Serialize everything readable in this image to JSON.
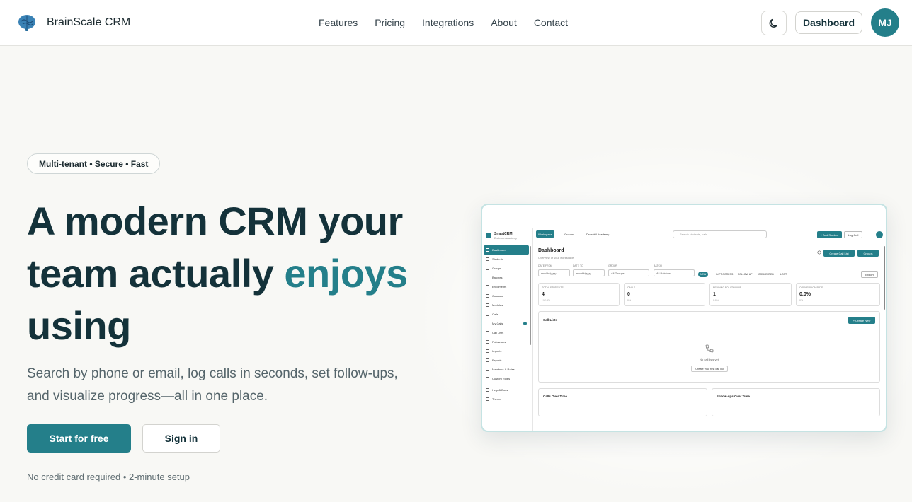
{
  "nav": {
    "brand": "BrainScale CRM",
    "links": [
      "Features",
      "Pricing",
      "Integrations",
      "About",
      "Contact"
    ],
    "dashboard_label": "Dashboard",
    "avatar_initials": "MJ"
  },
  "hero": {
    "pill": "Multi-tenant • Secure • Fast",
    "headline_part1": "A modern CRM your team actually ",
    "headline_accent": "enjoys",
    "headline_part2": " using",
    "subtext": "Search by phone or email, log calls in seconds, set follow-ups, and visualize progress—all in one place.",
    "primary_cta": "Start for free",
    "secondary_cta": "Sign in",
    "footnote": "No credit card required • 2-minute setup"
  },
  "mockup": {
    "brand_title": "SmartCRM",
    "brand_subtitle": "Brainiac Academy",
    "top_chips": [
      "Workspace",
      "Groups",
      "Drosebil Academy"
    ],
    "search_placeholder": "Search students, calls...",
    "add_student": "+ Add Student",
    "log_call": "Log Call",
    "sidebar": [
      "Dashboard",
      "Students",
      "Groups",
      "Batches",
      "Enrolments",
      "Courses",
      "Modules",
      "Calls",
      "My Calls",
      "Call Lists",
      "Follow-ups",
      "Imports",
      "Exports",
      "Members & Roles",
      "Custom Roles",
      "Help & Docs",
      "Theme"
    ],
    "title": "Dashboard",
    "subtitle": "Overview of your workspace",
    "create_call_list": "Create Call List",
    "groups_btn": "Groups",
    "filters": {
      "date_from_label": "DATE FROM",
      "date_to_label": "DATE TO",
      "group_label": "GROUP",
      "batch_label": "BATCH",
      "date_placeholder": "mm/dd/yyyy",
      "group_value": "All Groups",
      "batch_value": "All Batches"
    },
    "tabs": [
      "NEW",
      "IN PROGRESS",
      "FOLLOW UP",
      "CONVERTED",
      "LOST"
    ],
    "export": "Export",
    "kpis": [
      {
        "label": "TOTAL STUDENTS",
        "value": "4",
        "delta": "+12.4%"
      },
      {
        "label": "CALLS",
        "value": "0",
        "delta": "0%"
      },
      {
        "label": "PENDING FOLLOW-UPS",
        "value": "1",
        "delta": "0.0%"
      },
      {
        "label": "CONVERSION RATE",
        "value": "0.0%",
        "delta": "0%"
      }
    ],
    "call_lists_title": "Call Lists",
    "create_new": "+ Create New",
    "empty_text": "No call lists yet",
    "empty_btn": "Create your first call list",
    "chart1": "Calls Over Time",
    "chart2": "Follow-ups Over Time"
  }
}
